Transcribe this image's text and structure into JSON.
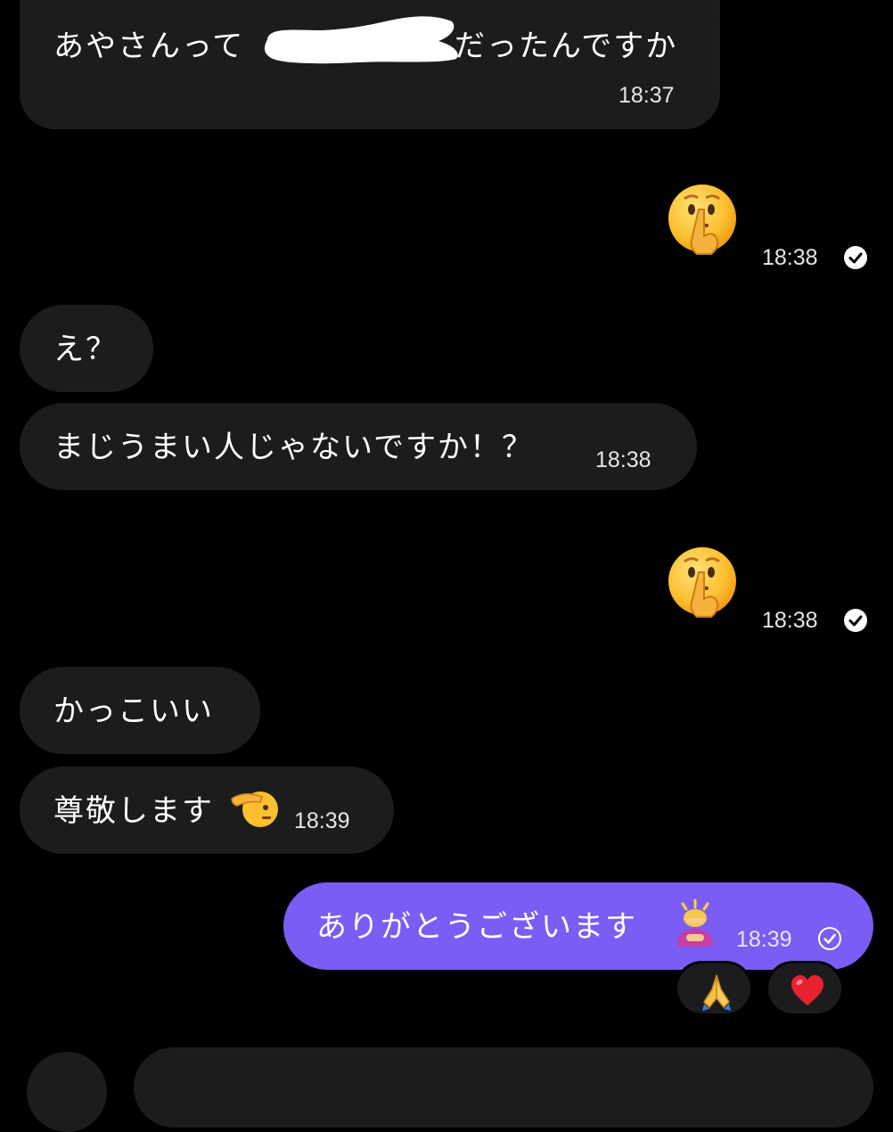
{
  "conversation": {
    "messages": [
      {
        "id": "m1",
        "side": "incoming",
        "text_before": "あやさんって",
        "text_after": "だったんですか",
        "time": "18:37"
      },
      {
        "id": "m2",
        "side": "outgoing",
        "emoji": "shushing-face",
        "time": "18:38",
        "read": true
      },
      {
        "id": "m3",
        "side": "incoming",
        "text": "え？"
      },
      {
        "id": "m4",
        "side": "incoming",
        "text": "まじうまい人じゃないですか！？",
        "time": "18:38"
      },
      {
        "id": "m5",
        "side": "outgoing",
        "emoji": "shushing-face",
        "time": "18:38",
        "read": true
      },
      {
        "id": "m6",
        "side": "incoming",
        "text": "かっこいい"
      },
      {
        "id": "m7",
        "side": "incoming",
        "text": "尊敬します",
        "emoji": "saluting-face",
        "time": "18:39"
      },
      {
        "id": "m8",
        "side": "outgoing",
        "text": "ありがとうございます",
        "emoji": "person-bowing",
        "time": "18:39",
        "read": true,
        "reactions": [
          {
            "emoji": "folded-hands"
          },
          {
            "emoji": "red-heart"
          }
        ]
      }
    ]
  },
  "colors": {
    "background": "#000000",
    "incoming_bubble": "#1c1c1e",
    "outgoing_bubble": "#7b5cf5",
    "text": "#ffffff",
    "redaction": "#ffffff"
  }
}
